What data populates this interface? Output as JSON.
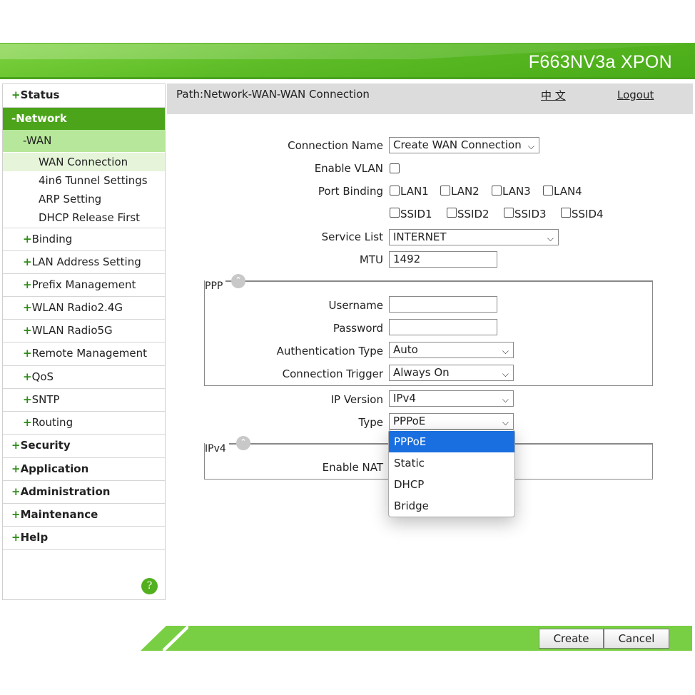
{
  "header": {
    "product": "F663NV3a XPON"
  },
  "sidebar": {
    "items": [
      {
        "label": "Status"
      },
      {
        "label": "Network"
      },
      {
        "label": "WAN"
      },
      {
        "label": "WAN Connection"
      },
      {
        "label": "4in6 Tunnel Settings"
      },
      {
        "label": "ARP Setting"
      },
      {
        "label": "DHCP Release First"
      },
      {
        "label": "Binding"
      },
      {
        "label": "LAN Address Setting"
      },
      {
        "label": "Prefix Management"
      },
      {
        "label": "WLAN Radio2.4G"
      },
      {
        "label": "WLAN Radio5G"
      },
      {
        "label": "Remote Management"
      },
      {
        "label": "QoS"
      },
      {
        "label": "SNTP"
      },
      {
        "label": "Routing"
      },
      {
        "label": "Security"
      },
      {
        "label": "Application"
      },
      {
        "label": "Administration"
      },
      {
        "label": "Maintenance"
      },
      {
        "label": "Help"
      }
    ],
    "plus": "+",
    "minus": "-",
    "help_icon": "?"
  },
  "pathbar": {
    "path": "Path:Network-WAN-WAN Connection",
    "lang": "中 文",
    "logout": "Logout"
  },
  "form": {
    "connection_name": {
      "label": "Connection Name",
      "value": "Create WAN Connection"
    },
    "enable_vlan": {
      "label": "Enable VLAN",
      "checked": false
    },
    "port_binding": {
      "label": "Port Binding",
      "ports": [
        "LAN1",
        "LAN2",
        "LAN3",
        "LAN4",
        "SSID1",
        "SSID2",
        "SSID3",
        "SSID4"
      ]
    },
    "service_list": {
      "label": "Service List",
      "value": "INTERNET"
    },
    "mtu": {
      "label": "MTU",
      "value": "1492"
    },
    "ppp": {
      "legend": "PPP",
      "username": {
        "label": "Username",
        "value": ""
      },
      "password": {
        "label": "Password",
        "value": ""
      },
      "auth_type": {
        "label": "Authentication Type",
        "value": "Auto"
      },
      "conn_trigger": {
        "label": "Connection Trigger",
        "value": "Always On"
      }
    },
    "ip_version": {
      "label": "IP Version",
      "value": "IPv4"
    },
    "type": {
      "label": "Type",
      "value": "PPPoE",
      "options": [
        "PPPoE",
        "Static",
        "DHCP",
        "Bridge"
      ]
    },
    "ipv4": {
      "legend": "IPv4",
      "enable_nat": {
        "label": "Enable NAT"
      }
    }
  },
  "footer": {
    "create": "Create",
    "cancel": "Cancel"
  },
  "icons": {
    "chevron": "chevron-down-icon",
    "collapse": "collapse-up-icon",
    "help": "help-icon"
  },
  "colors": {
    "brand_green": "#4ba419",
    "highlight": "#1a6fe0",
    "footer_green": "#79cf44"
  }
}
